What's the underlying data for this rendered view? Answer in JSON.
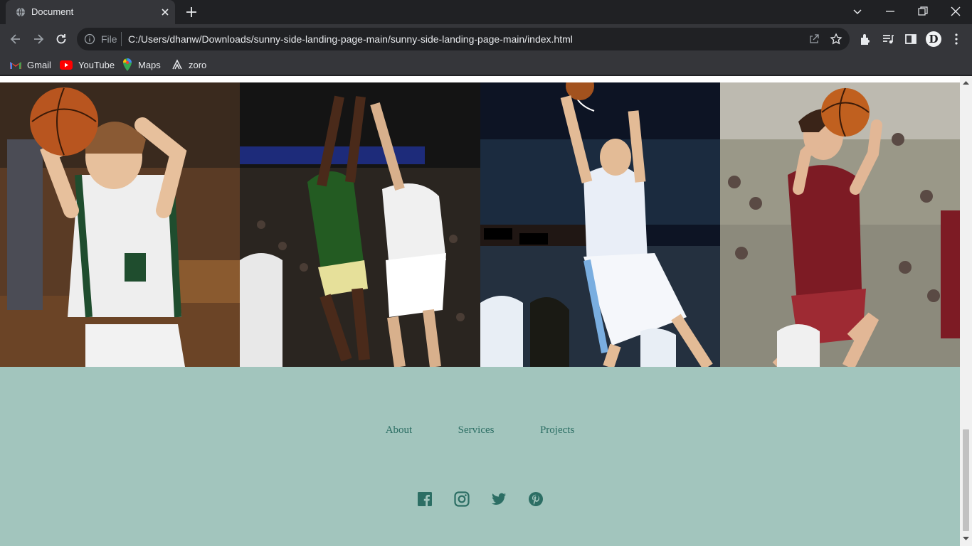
{
  "browser": {
    "tab_title": "Document",
    "address_scheme": "File",
    "address_url": "C:/Users/dhanw/Downloads/sunny-side-landing-page-main/sunny-side-landing-page-main/index.html",
    "profile_initial": "D",
    "bookmarks": [
      "Gmail",
      "YouTube",
      "Maps",
      "zoro"
    ]
  },
  "page": {
    "gallery": [
      {
        "icon": "basketball-player-photo-1"
      },
      {
        "icon": "basketball-player-photo-2"
      },
      {
        "icon": "basketball-player-photo-3"
      },
      {
        "icon": "basketball-player-photo-4"
      }
    ],
    "footer": {
      "links": [
        "About",
        "Services",
        "Projects"
      ],
      "social_icons": [
        "facebook-icon",
        "instagram-icon",
        "twitter-icon",
        "pinterest-icon"
      ],
      "accent": "#2c6e64",
      "background": "#a2c5bd"
    }
  }
}
